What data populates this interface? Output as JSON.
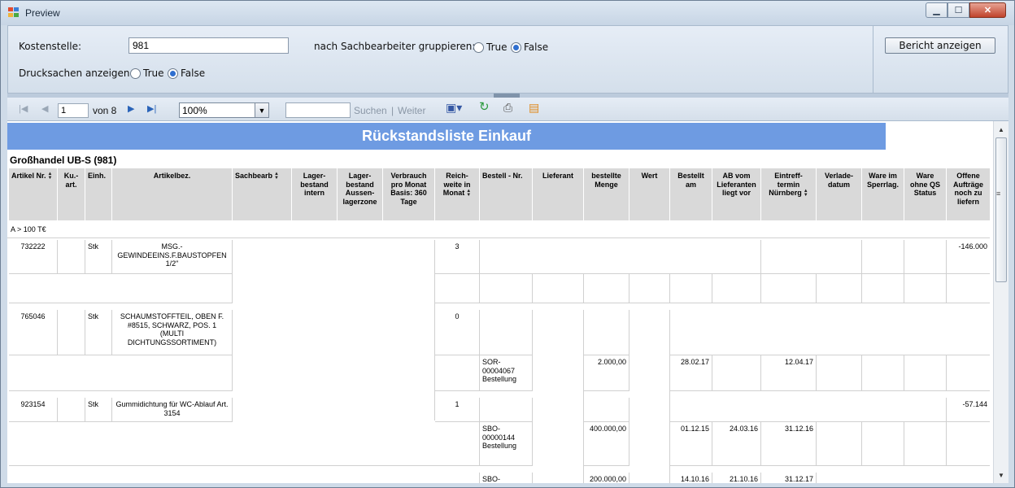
{
  "window": {
    "title": "Preview"
  },
  "params": {
    "kostenstelle_label": "Kostenstelle:",
    "kostenstelle_value": "981",
    "gruppieren_label": "nach Sachbearbeiter gruppieren:",
    "drucksachen_label": "Drucksachen anzeigen",
    "opt_true": "True",
    "opt_false": "False",
    "gruppieren_selected": "False",
    "drucksachen_selected": "False",
    "show_report_label": "Bericht anzeigen"
  },
  "toolbar": {
    "page": "1",
    "of_label": "von 8",
    "zoom": "100%",
    "search_label": "Suchen",
    "sep": "|",
    "next_label": "Weiter"
  },
  "report": {
    "title": "Rückstandsliste Einkauf",
    "group_header": "Großhandel UB-S (981)",
    "category": "A > 100 T€",
    "headers": {
      "artikel": "Artikel Nr.",
      "ku": "Ku.- art.",
      "einh": "Einh.",
      "artikelbez": "Artikelbez.",
      "sachbearb": "Sachbearb",
      "lager_intern": "Lager- bestand intern",
      "lager_aussen": "Lager- bestand Aussen- lagerzone",
      "verbrauch": "Verbrauch pro Monat Basis: 360 Tage",
      "reichweite": "Reich- weite in Monat",
      "bestell_nr": "Bestell - Nr.",
      "lieferant": "Lieferant",
      "bestellte_menge": "bestellte Menge",
      "wert": "Wert",
      "bestellt_am": "Bestellt am",
      "ab_vom": "AB vom Lieferanten liegt vor",
      "eintreff": "Eintreff- termin Nürnberg",
      "verlade": "Verlade- datum",
      "ware_sperr": "Ware im Sperrlag.",
      "ware_qs": "Ware ohne QS Status",
      "offene": "Offene Aufträge noch zu liefern"
    },
    "articles": [
      {
        "nr": "732222",
        "einh": "Stk",
        "bez": "MSG.- GEWINDEEINS.F.BAUSTOPFEN 1/2\"",
        "reichweite": "3",
        "offene": "-146.000"
      },
      {
        "nr": "765046",
        "einh": "Stk",
        "bez": "SCHAUMSTOFFTEIL, OBEN F. #8515, SCHWARZ, POS. 1 (MULTI DICHTUNGSSORTIMENT)",
        "reichweite": "0",
        "offene": ""
      },
      {
        "nr": "923154",
        "einh": "Stk",
        "bez": "Gummidichtung für WC-Ablauf Art. 3154",
        "reichweite": "1",
        "offene": "-57.144"
      }
    ],
    "orders": [
      {
        "bestell_nr": "SOR- 00004067 Bestellung",
        "menge": "2.000,00",
        "bestellt_am": "28.02.17",
        "ab_vom": "",
        "eintreff": "12.04.17"
      },
      {
        "bestell_nr": "SBO- 00000144 Bestellung",
        "menge": "400.000,00",
        "bestellt_am": "01.12.15",
        "ab_vom": "24.03.16",
        "eintreff": "31.12.16"
      },
      {
        "bestell_nr": "SBO-",
        "menge": "200.000,00",
        "bestellt_am": "14.10.16",
        "ab_vom": "21.10.16",
        "eintreff": "31.12.17"
      }
    ]
  },
  "colors": {
    "accent": "#6e9be2",
    "header_bg": "#d9d9d9",
    "chrome": "#d4dfeb"
  }
}
